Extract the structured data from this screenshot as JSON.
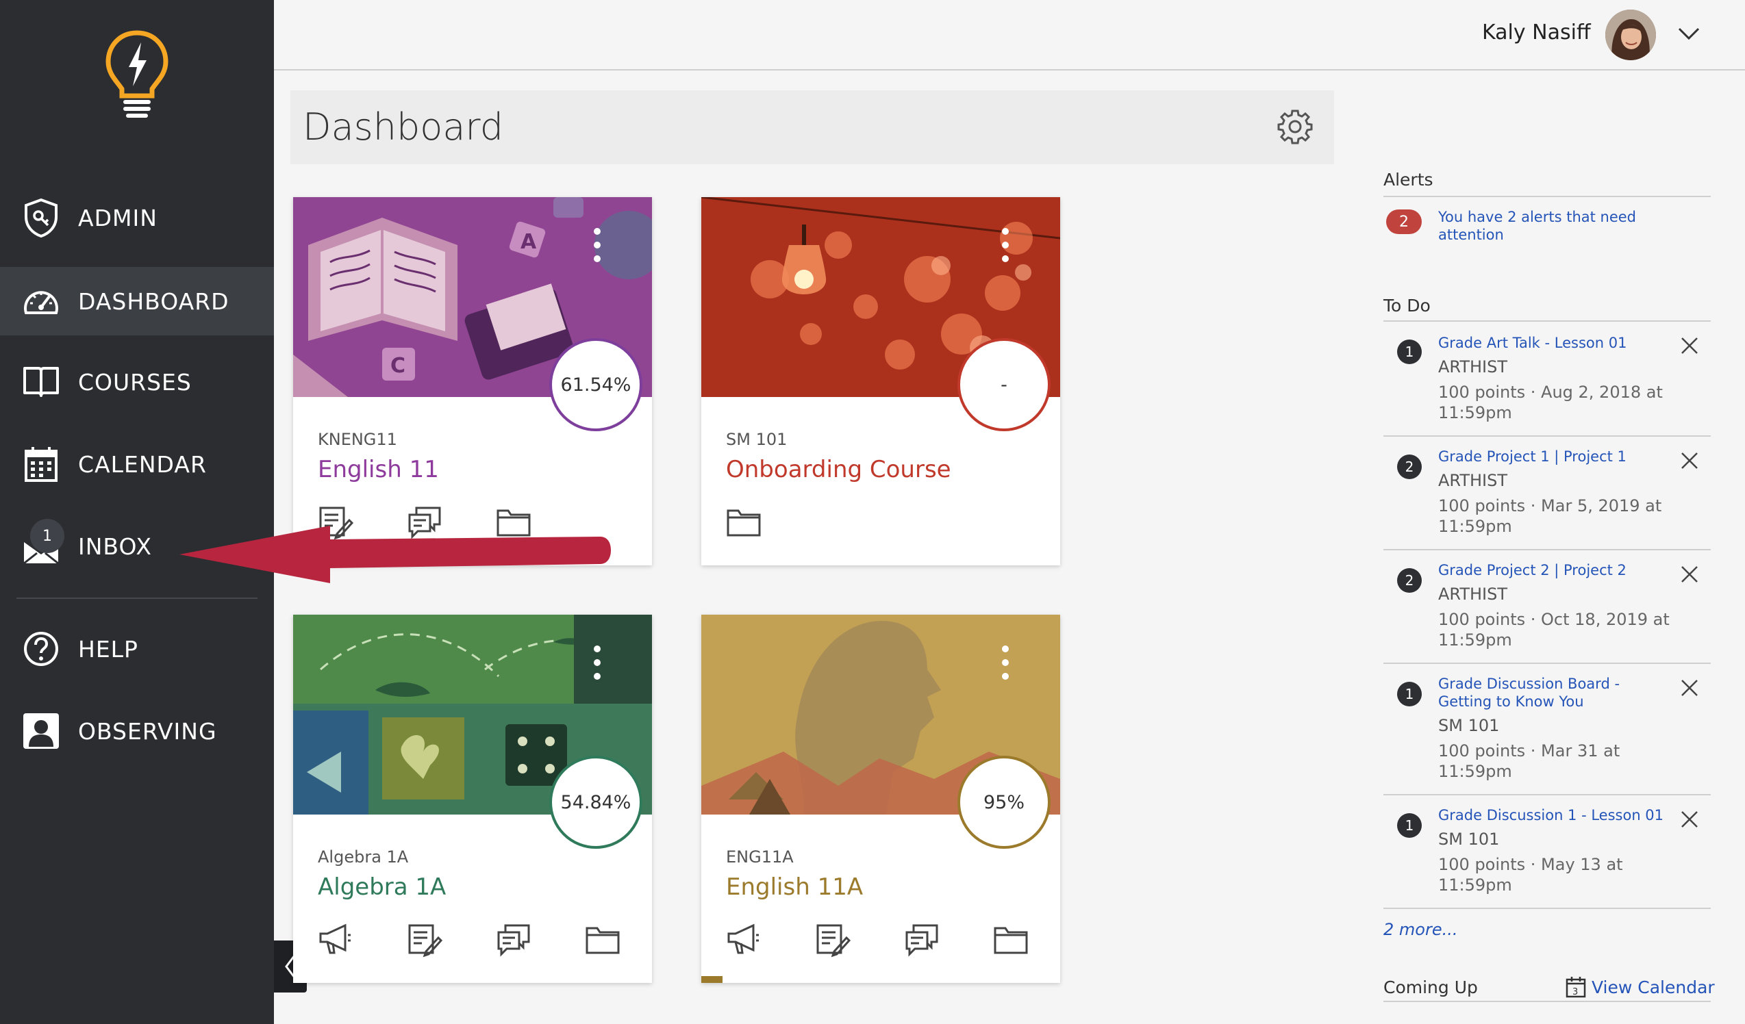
{
  "sidebar": {
    "items": [
      {
        "label": "ADMIN",
        "icon": "shield-icon"
      },
      {
        "label": "DASHBOARD",
        "icon": "gauge-icon",
        "active": true
      },
      {
        "label": "COURSES",
        "icon": "book-icon"
      },
      {
        "label": "CALENDAR",
        "icon": "calendar-icon"
      },
      {
        "label": "INBOX",
        "icon": "inbox-icon",
        "badge": "1"
      },
      {
        "label": "HELP",
        "icon": "help-icon"
      },
      {
        "label": "OBSERVING",
        "icon": "observer-icon"
      }
    ],
    "colors": {
      "bg": "#2b2d31",
      "active": "#3c3f44",
      "logo": "#f5a623"
    }
  },
  "topbar": {
    "user_name": "Kaly Nasiff"
  },
  "dashboard": {
    "title": "Dashboard"
  },
  "cards": [
    {
      "code": "KNENG11",
      "name": "English 11",
      "grade": "61.54%",
      "color": "#8e3a9c"
    },
    {
      "code": "SM 101",
      "name": "Onboarding Course",
      "grade": "-",
      "color": "#c0392b"
    },
    {
      "code": "Algebra 1A",
      "name": "Algebra 1A",
      "grade": "54.84%",
      "color": "#2e7a5a"
    },
    {
      "code": "ENG11A",
      "name": "English 11A",
      "grade": "95%",
      "color": "#9b7a2c",
      "progress": 0.06
    }
  ],
  "alerts": {
    "heading": "Alerts",
    "count": "2",
    "message": "You have 2 alerts that need attention"
  },
  "todo": {
    "heading": "To Do",
    "items": [
      {
        "num": "1",
        "title": "Grade Art Talk - Lesson 01",
        "course": "ARTHIST",
        "meta": "100 points · Aug 2, 2018 at 11:59pm"
      },
      {
        "num": "2",
        "title": "Grade Project 1 | Project 1",
        "course": "ARTHIST",
        "meta": "100 points · Mar 5, 2019 at 11:59pm"
      },
      {
        "num": "2",
        "title": "Grade Project 2 | Project 2",
        "course": "ARTHIST",
        "meta": "100 points · Oct 18, 2019 at 11:59pm"
      },
      {
        "num": "1",
        "title": "Grade Discussion Board - Getting to Know You",
        "course": "SM 101",
        "meta": "100 points · Mar 31 at 11:59pm"
      },
      {
        "num": "1",
        "title": "Grade Discussion 1 - Lesson 01",
        "course": "SM 101",
        "meta": "100 points · May 13 at 11:59pm"
      }
    ],
    "more": "2 more..."
  },
  "coming_up": {
    "heading": "Coming Up",
    "view_calendar": "View Calendar"
  },
  "annotation": {
    "arrow_color": "#b8253f"
  }
}
